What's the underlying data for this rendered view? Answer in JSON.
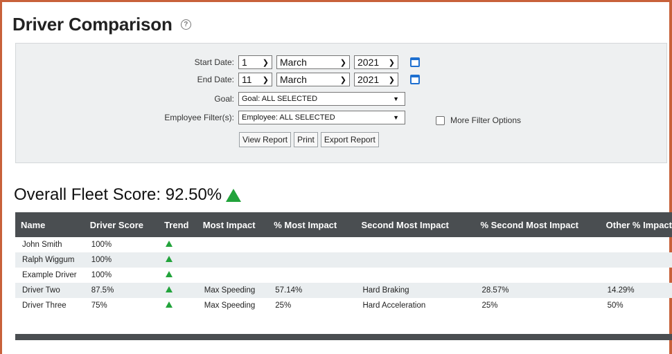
{
  "page": {
    "title": "Driver Comparison"
  },
  "filters": {
    "start_date_label": "Start Date:",
    "end_date_label": "End Date:",
    "goal_label": "Goal:",
    "employee_label": "Employee Filter(s):",
    "start_day": "1",
    "start_month": "March",
    "start_year": "2021",
    "end_day": "11",
    "end_month": "March",
    "end_year": "2021",
    "goal_value": "Goal: ALL SELECTED",
    "employee_value": "Employee: ALL SELECTED",
    "more_options_label": "More Filter Options",
    "more_options_checked": false,
    "view_report_label": "View Report",
    "print_label": "Print",
    "export_report_label": "Export Report"
  },
  "fleet": {
    "label": "Overall Fleet Score: 92.50%",
    "trend": "up"
  },
  "colors": {
    "accent_border": "#c8613a",
    "header_bg": "#4a4e51",
    "trend_up": "#22a33b",
    "calendar_icon": "#1d6fd0"
  },
  "table": {
    "columns": [
      "Name",
      "Driver Score",
      "Trend",
      "Most Impact",
      "% Most Impact",
      "Second Most Impact",
      "% Second Most Impact",
      "Other % Impact"
    ],
    "rows": [
      {
        "name": "John Smith",
        "score": "100%",
        "trend": "up",
        "most": "",
        "pct_most": "",
        "second": "",
        "pct_second": "",
        "other": ""
      },
      {
        "name": "Ralph Wiggum",
        "score": "100%",
        "trend": "up",
        "most": "",
        "pct_most": "",
        "second": "",
        "pct_second": "",
        "other": ""
      },
      {
        "name": "Example Driver",
        "score": "100%",
        "trend": "up",
        "most": "",
        "pct_most": "",
        "second": "",
        "pct_second": "",
        "other": ""
      },
      {
        "name": "Driver Two",
        "score": "87.5%",
        "trend": "up",
        "most": "Max Speeding",
        "pct_most": "57.14%",
        "second": "Hard Braking",
        "pct_second": "28.57%",
        "other": "14.29%"
      },
      {
        "name": "Driver Three",
        "score": "75%",
        "trend": "up",
        "most": "Max Speeding",
        "pct_most": "25%",
        "second": "Hard Acceleration",
        "pct_second": "25%",
        "other": "50%"
      }
    ]
  }
}
